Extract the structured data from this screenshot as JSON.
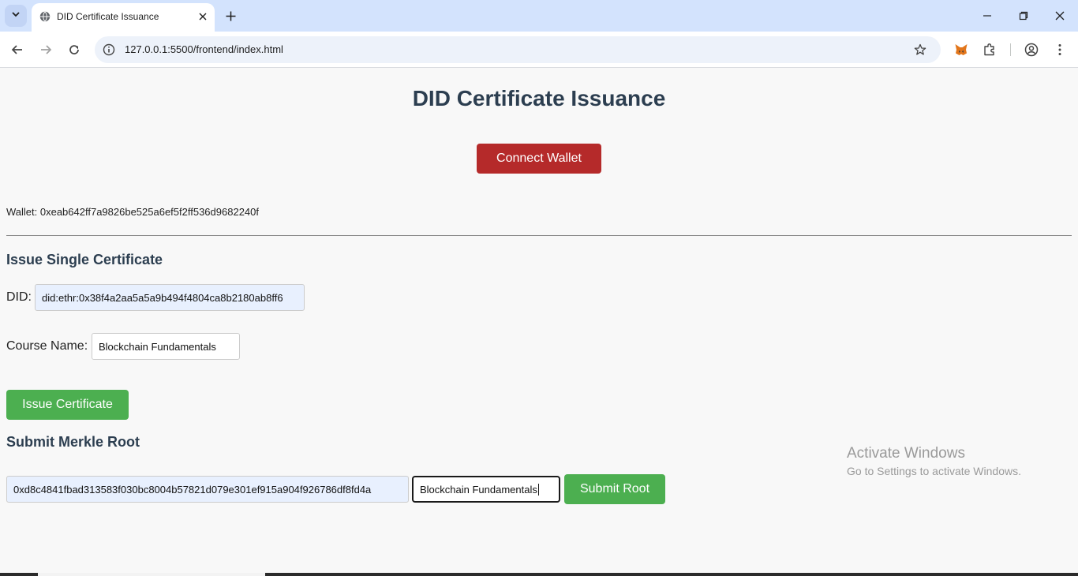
{
  "browser": {
    "tab_title": "DID Certificate Issuance",
    "url": "127.0.0.1:5500/frontend/index.html",
    "icons": {
      "tab_search": "chevron-down-icon",
      "favicon": "globe-icon",
      "tab_close": "close-icon",
      "new_tab": "plus-icon",
      "minimize": "minimize-icon",
      "restore": "restore-icon",
      "window_close": "close-icon",
      "back": "arrow-left-icon",
      "forward": "arrow-right-icon",
      "reload": "reload-icon",
      "site_info": "info-icon",
      "bookmark": "star-icon",
      "metamask": "fox-icon",
      "extensions": "puzzle-icon",
      "profile": "profile-icon",
      "menu": "kebab-menu-icon"
    }
  },
  "page": {
    "title": "DID Certificate Issuance",
    "connect_button": "Connect Wallet",
    "wallet_text": "Wallet: 0xeab642ff7a9826be525a6ef5f2ff536d9682240f",
    "single": {
      "heading": "Issue Single Certificate",
      "did_label": "DID:",
      "did_value": "did:ethr:0x38f4a2aa5a5a9b494f4804ca8b2180ab8ff6",
      "course_label": "Course Name:",
      "course_value": "Blockchain Fundamentals",
      "issue_button": "Issue Certificate"
    },
    "merkle": {
      "heading": "Submit Merkle Root",
      "root_value": "0xd8c4841fbad313583f030bc8004b57821d079e301ef915a904f926786df8fd4a",
      "course_value": "Blockchain Fundamentals",
      "submit_button": "Submit Root"
    }
  },
  "watermark": {
    "line1": "Activate Windows",
    "line2": "Go to Settings to activate Windows."
  },
  "colors": {
    "connect_button": "#b52a2a",
    "green_button": "#4caf50",
    "heading": "#2c3e50",
    "tab_strip": "#d3e3fd"
  }
}
